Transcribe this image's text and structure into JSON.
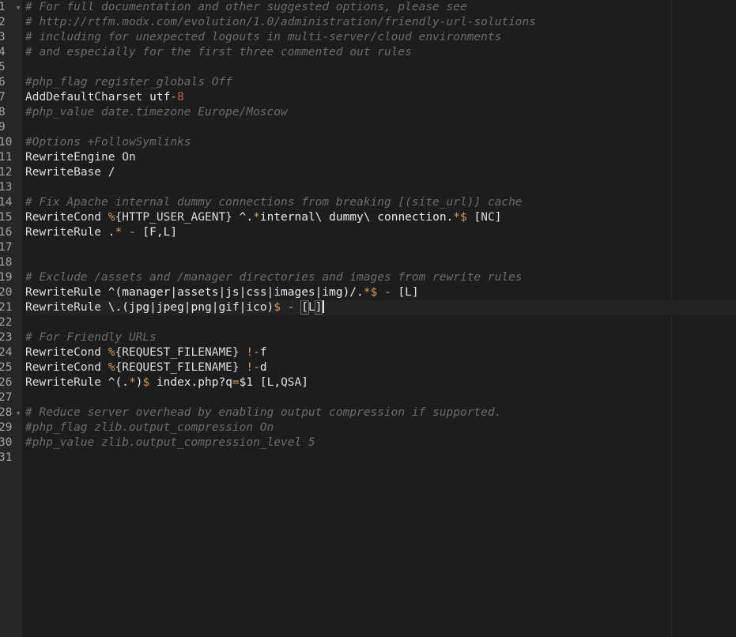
{
  "editor": {
    "colors": {
      "background": "#1d1d1d",
      "gutter": "#262626",
      "line_number": "#a4a4a4",
      "comment": "#6b6b6b",
      "keyword": "#dcdcdc",
      "operator": "#d49b5c",
      "string": "#cd5b4f",
      "plain": "#e8e8e8"
    },
    "cursor": {
      "line": 21
    },
    "fold_markers": [
      {
        "line": 1,
        "glyph": "▾"
      },
      {
        "line": 28,
        "glyph": "▾"
      }
    ],
    "lines": [
      {
        "n": "1",
        "tokens": [
          {
            "t": "# For full documentation and other suggested options, please see",
            "c": "comment"
          }
        ]
      },
      {
        "n": "2",
        "tokens": [
          {
            "t": "# http://rtfm.modx.com/evolution/1.0/administration/friendly-url-solutions",
            "c": "comment"
          }
        ]
      },
      {
        "n": "3",
        "tokens": [
          {
            "t": "# including for unexpected logouts in multi-server/cloud environments",
            "c": "comment"
          }
        ]
      },
      {
        "n": "4",
        "tokens": [
          {
            "t": "# and especially for the first three commented out rules",
            "c": "comment"
          }
        ]
      },
      {
        "n": "5",
        "tokens": []
      },
      {
        "n": "6",
        "tokens": [
          {
            "t": "#php_flag register_globals Off",
            "c": "comment"
          }
        ]
      },
      {
        "n": "7",
        "tokens": [
          {
            "t": "AddDefaultCharset ",
            "c": "keyword"
          },
          {
            "t": "utf",
            "c": "plain"
          },
          {
            "t": "-",
            "c": "operator"
          },
          {
            "t": "8",
            "c": "string"
          }
        ]
      },
      {
        "n": "8",
        "tokens": [
          {
            "t": "#php_value date.timezone Europe/Moscow",
            "c": "comment"
          }
        ]
      },
      {
        "n": "9",
        "tokens": []
      },
      {
        "n": "10",
        "tokens": [
          {
            "t": "#Options +FollowSymlinks",
            "c": "comment"
          }
        ]
      },
      {
        "n": "11",
        "tokens": [
          {
            "t": "RewriteEngine On",
            "c": "keyword"
          }
        ]
      },
      {
        "n": "12",
        "tokens": [
          {
            "t": "RewriteBase ",
            "c": "keyword"
          },
          {
            "t": "/",
            "c": "plain"
          }
        ]
      },
      {
        "n": "13",
        "tokens": []
      },
      {
        "n": "14",
        "tokens": [
          {
            "t": "# Fix Apache internal dummy connections from breaking [(site_url)] cache",
            "c": "comment"
          }
        ]
      },
      {
        "n": "15",
        "tokens": [
          {
            "t": "RewriteCond ",
            "c": "keyword"
          },
          {
            "t": "%",
            "c": "operator"
          },
          {
            "t": "{HTTP_USER_AGENT}",
            "c": "keyword"
          },
          {
            "t": " ^.",
            "c": "plain"
          },
          {
            "t": "*",
            "c": "operator"
          },
          {
            "t": "internal\\ dummy\\ connection.",
            "c": "plain"
          },
          {
            "t": "*$",
            "c": "operator"
          },
          {
            "t": " [",
            "c": "plain"
          },
          {
            "t": "NC",
            "c": "keyword"
          },
          {
            "t": "]",
            "c": "plain"
          }
        ]
      },
      {
        "n": "16",
        "tokens": [
          {
            "t": "RewriteRule ",
            "c": "keyword"
          },
          {
            "t": ".",
            "c": "plain"
          },
          {
            "t": "*",
            "c": "operator"
          },
          {
            "t": " ",
            "c": "plain"
          },
          {
            "t": "-",
            "c": "operator"
          },
          {
            "t": " [F,L]",
            "c": "plain"
          }
        ]
      },
      {
        "n": "17",
        "tokens": []
      },
      {
        "n": "18",
        "tokens": []
      },
      {
        "n": "19",
        "tokens": [
          {
            "t": "# Exclude /assets and /manager directories and images from rewrite rules",
            "c": "comment"
          }
        ]
      },
      {
        "n": "20",
        "tokens": [
          {
            "t": "RewriteRule ",
            "c": "keyword"
          },
          {
            "t": "^(manager|assets|js|css|images|img)/.",
            "c": "plain"
          },
          {
            "t": "*$",
            "c": "operator"
          },
          {
            "t": " ",
            "c": "plain"
          },
          {
            "t": "-",
            "c": "operator"
          },
          {
            "t": " [L]",
            "c": "plain"
          }
        ]
      },
      {
        "n": "21",
        "tokens": [
          {
            "t": "RewriteRule ",
            "c": "keyword"
          },
          {
            "t": "\\.(jpg|jpeg|png|gif|ico)",
            "c": "plain"
          },
          {
            "t": "$",
            "c": "operator"
          },
          {
            "t": " ",
            "c": "plain"
          },
          {
            "t": "-",
            "c": "operator"
          },
          {
            "t": " ",
            "c": "plain"
          },
          {
            "t": "[",
            "c": "bracket"
          },
          {
            "t": "L",
            "c": "plain"
          },
          {
            "t": "]",
            "c": "bracket"
          }
        ]
      },
      {
        "n": "22",
        "tokens": []
      },
      {
        "n": "23",
        "tokens": [
          {
            "t": "# For Friendly URLs",
            "c": "comment"
          }
        ]
      },
      {
        "n": "24",
        "tokens": [
          {
            "t": "RewriteCond ",
            "c": "keyword"
          },
          {
            "t": "%",
            "c": "operator"
          },
          {
            "t": "{REQUEST_FILENAME}",
            "c": "keyword"
          },
          {
            "t": " ",
            "c": "plain"
          },
          {
            "t": "!-",
            "c": "operator"
          },
          {
            "t": "f",
            "c": "plain"
          }
        ]
      },
      {
        "n": "25",
        "tokens": [
          {
            "t": "RewriteCond ",
            "c": "keyword"
          },
          {
            "t": "%",
            "c": "operator"
          },
          {
            "t": "{REQUEST_FILENAME}",
            "c": "keyword"
          },
          {
            "t": " ",
            "c": "plain"
          },
          {
            "t": "!-",
            "c": "operator"
          },
          {
            "t": "d",
            "c": "plain"
          }
        ]
      },
      {
        "n": "26",
        "tokens": [
          {
            "t": "RewriteRule ",
            "c": "keyword"
          },
          {
            "t": "^(.",
            "c": "plain"
          },
          {
            "t": "*",
            "c": "operator"
          },
          {
            "t": ")",
            "c": "plain"
          },
          {
            "t": "$",
            "c": "operator"
          },
          {
            "t": " index.php?q",
            "c": "plain"
          },
          {
            "t": "=",
            "c": "operator"
          },
          {
            "t": "$1 [L,",
            "c": "plain"
          },
          {
            "t": "QSA",
            "c": "keyword"
          },
          {
            "t": "]",
            "c": "plain"
          }
        ]
      },
      {
        "n": "27",
        "tokens": []
      },
      {
        "n": "28",
        "tokens": [
          {
            "t": "# Reduce server overhead by enabling output compression if supported.",
            "c": "comment"
          }
        ]
      },
      {
        "n": "29",
        "tokens": [
          {
            "t": "#php_flag zlib.output_compression On",
            "c": "comment"
          }
        ]
      },
      {
        "n": "30",
        "tokens": [
          {
            "t": "#php_value zlib.output_compression_level 5",
            "c": "comment"
          }
        ]
      },
      {
        "n": "31",
        "tokens": []
      }
    ]
  }
}
